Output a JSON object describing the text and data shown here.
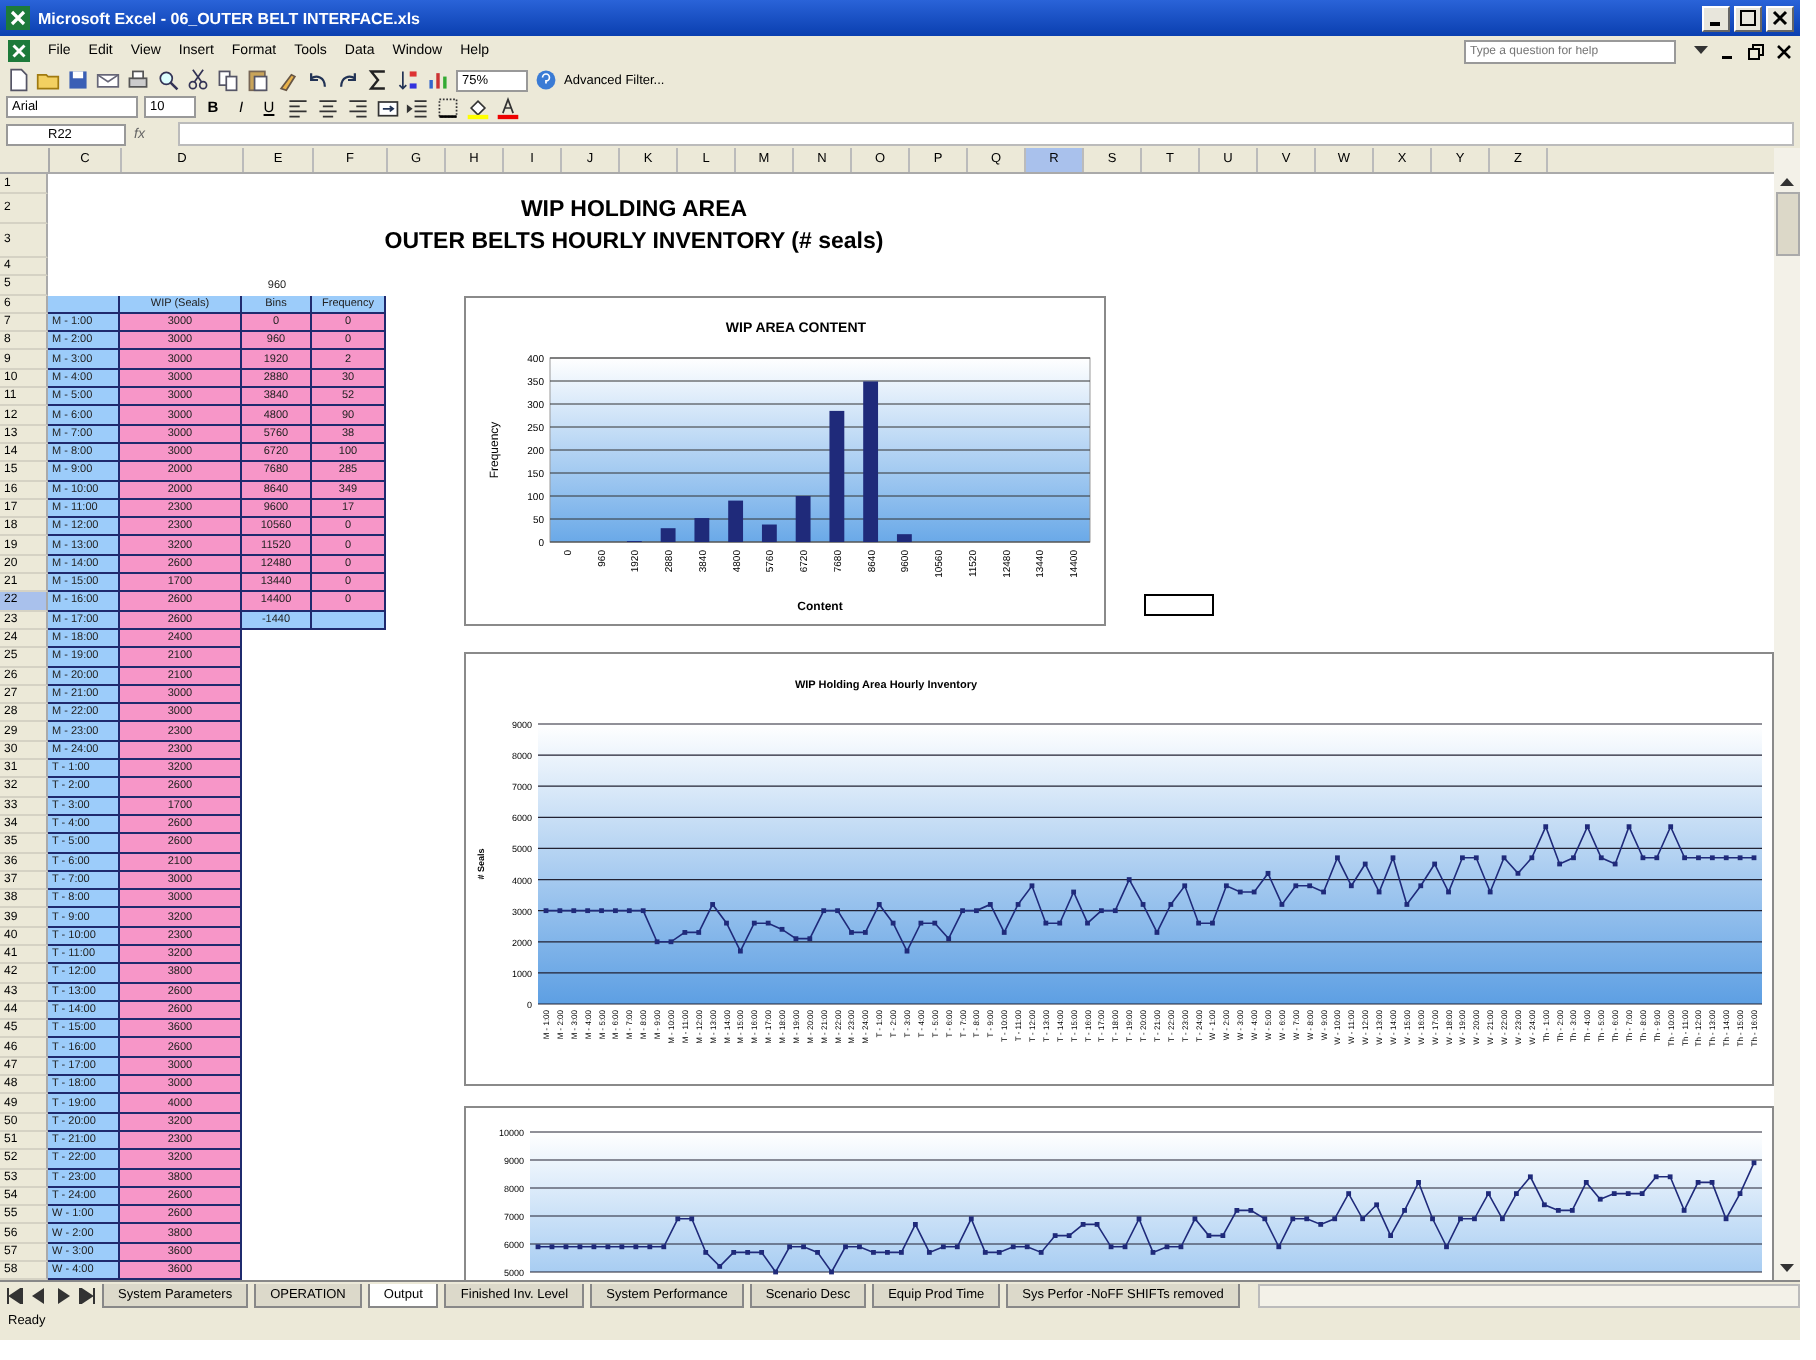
{
  "window": {
    "title": "Microsoft Excel - 06_OUTER BELT INTERFACE.xls"
  },
  "menu": [
    "File",
    "Edit",
    "View",
    "Insert",
    "Format",
    "Tools",
    "Data",
    "Window",
    "Help"
  ],
  "help_box": {
    "placeholder": "Type a question for help"
  },
  "toolbar": {
    "zoom": "75%",
    "advanced_filter": "Advanced Filter..."
  },
  "format_bar": {
    "font": "Arial",
    "size": "10",
    "buttons": [
      "B",
      "I",
      "U"
    ]
  },
  "formula_bar": {
    "name_box": "R22",
    "fx": "fx"
  },
  "sheet": {
    "columns": [
      {
        "label": "C",
        "selected": false
      },
      {
        "label": "D",
        "selected": false
      },
      {
        "label": "E",
        "selected": false
      },
      {
        "label": "F",
        "selected": false
      },
      {
        "label": "G",
        "selected": false
      },
      {
        "label": "H",
        "selected": false
      },
      {
        "label": "I",
        "selected": false
      },
      {
        "label": "J",
        "selected": false
      },
      {
        "label": "K",
        "selected": false
      },
      {
        "label": "L",
        "selected": false
      },
      {
        "label": "M",
        "selected": false
      },
      {
        "label": "N",
        "selected": false
      },
      {
        "label": "O",
        "selected": false
      },
      {
        "label": "P",
        "selected": false
      },
      {
        "label": "Q",
        "selected": false
      },
      {
        "label": "R",
        "selected": true
      },
      {
        "label": "S",
        "selected": false
      },
      {
        "label": "T",
        "selected": false
      },
      {
        "label": "U",
        "selected": false
      },
      {
        "label": "V",
        "selected": false
      },
      {
        "label": "W",
        "selected": false
      },
      {
        "label": "X",
        "selected": false
      },
      {
        "label": "Y",
        "selected": false
      },
      {
        "label": "Z",
        "selected": false
      }
    ],
    "rows": [
      {
        "number": "1",
        "selected": false,
        "kind": "blank"
      },
      {
        "number": "2",
        "selected": false,
        "kind": "title",
        "title": "WIP HOLDING AREA"
      },
      {
        "number": "3",
        "selected": false,
        "kind": "title",
        "title": "OUTER BELTS HOURLY INVENTORY (# seals)"
      },
      {
        "number": "4",
        "selected": false,
        "kind": "blank"
      },
      {
        "number": "5",
        "selected": false,
        "kind": "note",
        "bin": "960"
      },
      {
        "number": "6",
        "selected": false,
        "kind": "header",
        "wip": "WIP (Seals)",
        "bin": "Bins",
        "frequency": "Frequency"
      },
      {
        "number": "7",
        "selected": false,
        "kind": "data",
        "time": "M - 1:00",
        "wip": "3000",
        "bin": "0",
        "frequency": "0"
      },
      {
        "number": "8",
        "selected": false,
        "kind": "data",
        "time": "M - 2:00",
        "wip": "3000",
        "bin": "960",
        "frequency": "0"
      },
      {
        "number": "9",
        "selected": false,
        "kind": "data",
        "time": "M - 3:00",
        "wip": "3000",
        "bin": "1920",
        "frequency": "2"
      },
      {
        "number": "10",
        "selected": false,
        "kind": "data",
        "time": "M - 4:00",
        "wip": "3000",
        "bin": "2880",
        "frequency": "30"
      },
      {
        "number": "11",
        "selected": false,
        "kind": "data",
        "time": "M - 5:00",
        "wip": "3000",
        "bin": "3840",
        "frequency": "52"
      },
      {
        "number": "12",
        "selected": false,
        "kind": "data",
        "time": "M - 6:00",
        "wip": "3000",
        "bin": "4800",
        "frequency": "90"
      },
      {
        "number": "13",
        "selected": false,
        "kind": "data",
        "time": "M - 7:00",
        "wip": "3000",
        "bin": "5760",
        "frequency": "38"
      },
      {
        "number": "14",
        "selected": false,
        "kind": "data",
        "time": "M - 8:00",
        "wip": "3000",
        "bin": "6720",
        "frequency": "100"
      },
      {
        "number": "15",
        "selected": false,
        "kind": "data",
        "time": "M - 9:00",
        "wip": "2000",
        "bin": "7680",
        "frequency": "285"
      },
      {
        "number": "16",
        "selected": false,
        "kind": "data",
        "time": "M - 10:00",
        "wip": "2000",
        "bin": "8640",
        "frequency": "349"
      },
      {
        "number": "17",
        "selected": false,
        "kind": "data",
        "time": "M - 11:00",
        "wip": "2300",
        "bin": "9600",
        "frequency": "17"
      },
      {
        "number": "18",
        "selected": false,
        "kind": "data",
        "time": "M - 12:00",
        "wip": "2300",
        "bin": "10560",
        "frequency": "0"
      },
      {
        "number": "19",
        "selected": false,
        "kind": "data",
        "time": "M - 13:00",
        "wip": "3200",
        "bin": "11520",
        "frequency": "0"
      },
      {
        "number": "20",
        "selected": false,
        "kind": "data",
        "time": "M - 14:00",
        "wip": "2600",
        "bin": "12480",
        "frequency": "0"
      },
      {
        "number": "21",
        "selected": false,
        "kind": "data",
        "time": "M - 15:00",
        "wip": "1700",
        "bin": "13440",
        "frequency": "0"
      },
      {
        "number": "22",
        "selected": true,
        "kind": "data",
        "time": "M - 16:00",
        "wip": "2600",
        "bin": "14400",
        "frequency": "0"
      },
      {
        "number": "23",
        "selected": false,
        "kind": "data",
        "time": "M - 17:00",
        "wip": "2600",
        "bin": "-1440"
      },
      {
        "number": "24",
        "selected": false,
        "kind": "data",
        "time": "M - 18:00",
        "wip": "2400"
      },
      {
        "number": "25",
        "selected": false,
        "kind": "data",
        "time": "M - 19:00",
        "wip": "2100"
      },
      {
        "number": "26",
        "selected": false,
        "kind": "data",
        "time": "M - 20:00",
        "wip": "2100"
      },
      {
        "number": "27",
        "selected": false,
        "kind": "data",
        "time": "M - 21:00",
        "wip": "3000"
      },
      {
        "number": "28",
        "selected": false,
        "kind": "data",
        "time": "M - 22:00",
        "wip": "3000"
      },
      {
        "number": "29",
        "selected": false,
        "kind": "data",
        "time": "M - 23:00",
        "wip": "2300"
      },
      {
        "number": "30",
        "selected": false,
        "kind": "data",
        "time": "M - 24:00",
        "wip": "2300"
      },
      {
        "number": "31",
        "selected": false,
        "kind": "data",
        "time": "T - 1:00",
        "wip": "3200"
      },
      {
        "number": "32",
        "selected": false,
        "kind": "data",
        "time": "T - 2:00",
        "wip": "2600"
      },
      {
        "number": "33",
        "selected": false,
        "kind": "data",
        "time": "T - 3:00",
        "wip": "1700"
      },
      {
        "number": "34",
        "selected": false,
        "kind": "data",
        "time": "T - 4:00",
        "wip": "2600"
      },
      {
        "number": "35",
        "selected": false,
        "kind": "data",
        "time": "T - 5:00",
        "wip": "2600"
      },
      {
        "number": "36",
        "selected": false,
        "kind": "data",
        "time": "T - 6:00",
        "wip": "2100"
      },
      {
        "number": "37",
        "selected": false,
        "kind": "data",
        "time": "T - 7:00",
        "wip": "3000"
      },
      {
        "number": "38",
        "selected": false,
        "kind": "data",
        "time": "T - 8:00",
        "wip": "3000"
      },
      {
        "number": "39",
        "selected": false,
        "kind": "data",
        "time": "T - 9:00",
        "wip": "3200"
      },
      {
        "number": "40",
        "selected": false,
        "kind": "data",
        "time": "T - 10:00",
        "wip": "2300"
      },
      {
        "number": "41",
        "selected": false,
        "kind": "data",
        "time": "T - 11:00",
        "wip": "3200"
      },
      {
        "number": "42",
        "selected": false,
        "kind": "data",
        "time": "T - 12:00",
        "wip": "3800"
      },
      {
        "number": "43",
        "selected": false,
        "kind": "data",
        "time": "T - 13:00",
        "wip": "2600"
      },
      {
        "number": "44",
        "selected": false,
        "kind": "data",
        "time": "T - 14:00",
        "wip": "2600"
      },
      {
        "number": "45",
        "selected": false,
        "kind": "data",
        "time": "T - 15:00",
        "wip": "3600"
      },
      {
        "number": "46",
        "selected": false,
        "kind": "data",
        "time": "T - 16:00",
        "wip": "2600"
      },
      {
        "number": "47",
        "selected": false,
        "kind": "data",
        "time": "T - 17:00",
        "wip": "3000"
      },
      {
        "number": "48",
        "selected": false,
        "kind": "data",
        "time": "T - 18:00",
        "wip": "3000"
      },
      {
        "number": "49",
        "selected": false,
        "kind": "data",
        "time": "T - 19:00",
        "wip": "4000"
      },
      {
        "number": "50",
        "selected": false,
        "kind": "data",
        "time": "T - 20:00",
        "wip": "3200"
      },
      {
        "number": "51",
        "selected": false,
        "kind": "data",
        "time": "T - 21:00",
        "wip": "2300"
      },
      {
        "number": "52",
        "selected": false,
        "kind": "data",
        "time": "T - 22:00",
        "wip": "3200"
      },
      {
        "number": "53",
        "selected": false,
        "kind": "data",
        "time": "T - 23:00",
        "wip": "3800"
      },
      {
        "number": "54",
        "selected": false,
        "kind": "data",
        "time": "T - 24:00",
        "wip": "2600"
      },
      {
        "number": "55",
        "selected": false,
        "kind": "data",
        "time": "W - 1:00",
        "wip": "2600"
      },
      {
        "number": "56",
        "selected": false,
        "kind": "data",
        "time": "W - 2:00",
        "wip": "3800"
      },
      {
        "number": "57",
        "selected": false,
        "kind": "data",
        "time": "W - 3:00",
        "wip": "3600"
      },
      {
        "number": "58",
        "selected": false,
        "kind": "data",
        "time": "W - 4:00",
        "wip": "3600"
      }
    ],
    "histogram": {
      "chart_data": {
        "type": "bar",
        "title": "WIP AREA CONTENT",
        "xlabel": "Content",
        "ylabel": "Frequency",
        "categories": [
          "0",
          "960",
          "1920",
          "2880",
          "3840",
          "4800",
          "5760",
          "6720",
          "7680",
          "8640",
          "9600",
          "10560",
          "11520",
          "12480",
          "13440",
          "14400"
        ],
        "values": [
          0,
          0,
          2,
          30,
          52,
          90,
          38,
          100,
          285,
          349,
          17,
          0,
          0,
          0,
          0,
          0
        ],
        "grid": true,
        "ylim": [
          0,
          400
        ],
        "yticks": [
          0,
          50,
          100,
          150,
          200,
          250,
          300,
          350,
          400
        ]
      }
    },
    "hourly_chart": {
      "chart_data": {
        "type": "line",
        "title": "WIP Holding Area Hourly Inventory",
        "ylabel": "# Seals",
        "categories": [
          "M - 1:00",
          "M - 2:00",
          "M - 3:00",
          "M - 4:00",
          "M - 5:00",
          "M - 6:00",
          "M - 7:00",
          "M - 8:00",
          "M - 9:00",
          "M - 10:00",
          "M - 11:00",
          "M - 12:00",
          "M - 13:00",
          "M - 14:00",
          "M - 15:00",
          "M - 16:00",
          "M - 17:00",
          "M - 18:00",
          "M - 19:00",
          "M - 20:00",
          "M - 21:00",
          "M - 22:00",
          "M - 23:00",
          "M - 24:00",
          "T - 1:00",
          "T - 2:00",
          "T - 3:00",
          "T - 4:00",
          "T - 5:00",
          "T - 6:00",
          "T - 7:00",
          "T - 8:00",
          "T - 9:00",
          "T - 10:00",
          "T - 11:00",
          "T - 12:00",
          "T - 13:00",
          "T - 14:00",
          "T - 15:00",
          "T - 16:00",
          "T - 17:00",
          "T - 18:00",
          "T - 19:00",
          "T - 20:00",
          "T - 21:00",
          "T - 22:00",
          "T - 23:00",
          "T - 24:00",
          "W - 1:00",
          "W - 2:00",
          "W - 3:00",
          "W - 4:00",
          "W - 5:00",
          "W - 6:00",
          "W - 7:00",
          "W - 8:00",
          "W - 9:00",
          "W - 10:00",
          "W - 11:00",
          "W - 12:00",
          "W - 13:00",
          "W - 14:00",
          "W - 15:00",
          "W - 16:00",
          "W - 17:00",
          "W - 18:00",
          "W - 19:00",
          "W - 20:00",
          "W - 21:00",
          "W - 22:00",
          "W - 23:00",
          "W - 24:00",
          "Th - 1:00",
          "Th - 2:00",
          "Th - 3:00",
          "Th - 4:00",
          "Th - 5:00",
          "Th - 6:00",
          "Th - 7:00",
          "Th - 8:00",
          "Th - 9:00",
          "Th - 10:00",
          "Th - 11:00",
          "Th - 12:00",
          "Th - 13:00",
          "Th - 14:00",
          "Th - 15:00",
          "Th - 16:00"
        ],
        "grid": true,
        "series": [
          {
            "color": "#1f2a7a",
            "marker": "square",
            "values": [
              3000,
              3000,
              3000,
              3000,
              3000,
              3000,
              3000,
              3000,
              2000,
              2000,
              2300,
              2300,
              3200,
              2600,
              1700,
              2600,
              2600,
              2400,
              2100,
              2100,
              3000,
              3000,
              2300,
              2300,
              3200,
              2600,
              1700,
              2600,
              2600,
              2100,
              3000,
              3000,
              3200,
              2300,
              3200,
              3800,
              2600,
              2600,
              3600,
              2600,
              3000,
              3000,
              4000,
              3200,
              2300,
              3200,
              3800,
              2600,
              2600,
              3800,
              3600,
              3600,
              4200,
              3200,
              3800,
              3800,
              3600,
              4700,
              3800,
              4500,
              3600,
              4700,
              3200,
              3800,
              4500,
              3600,
              4700,
              4700,
              3600,
              4700,
              4200,
              4700,
              5700,
              4500,
              4700,
              5700,
              4700,
              4500,
              5700,
              4700,
              4700,
              5700,
              4700,
              4700,
              4700,
              4700,
              4700,
              4700
            ]
          }
        ],
        "ylim": [
          0,
          9000
        ],
        "yticks": [
          0,
          1000,
          2000,
          3000,
          4000,
          5000,
          6000,
          7000,
          8000,
          9000
        ]
      }
    },
    "second_chart": {
      "chart_data": {
        "type": "line",
        "grid": true,
        "series": [
          {
            "color": "#1f2a7a",
            "marker": "square",
            "values": [
              5900,
              5900,
              5900,
              5900,
              5900,
              5900,
              5900,
              5900,
              5900,
              5900,
              6900,
              6900,
              5700,
              5200,
              5700,
              5700,
              5700,
              5000,
              5900,
              5900,
              5700,
              5000,
              5900,
              5900,
              5700,
              5700,
              5700,
              6700,
              5700,
              5900,
              5900,
              6900,
              5700,
              5700,
              5900,
              5900,
              5700,
              6300,
              6300,
              6700,
              6700,
              5900,
              5900,
              6900,
              5700,
              5900,
              5900,
              6900,
              6300,
              6300,
              7200,
              7200,
              6900,
              5900,
              6900,
              6900,
              6700,
              6900,
              7800,
              6900,
              7400,
              6300,
              7200,
              8200,
              6900,
              5900,
              6900,
              6900,
              7800,
              6900,
              7800,
              8400,
              7400,
              7200,
              7200,
              8200,
              7600,
              7800,
              7800,
              7800,
              8400,
              8400,
              7200,
              8200,
              8200,
              6900,
              7800,
              8900
            ]
          }
        ],
        "ylim": [
          5000,
          10000
        ],
        "yticks": [
          5000,
          6000,
          7000,
          8000,
          9000,
          10000
        ]
      }
    }
  },
  "tabs": [
    {
      "label": "System Parameters",
      "selected": false
    },
    {
      "label": "OPERATION",
      "selected": false
    },
    {
      "label": "Output",
      "selected": true
    },
    {
      "label": "Finished Inv. Level",
      "selected": false
    },
    {
      "label": "System Performance",
      "selected": false
    },
    {
      "label": "Scenario Desc",
      "selected": false
    },
    {
      "label": "Equip Prod Time",
      "selected": false
    },
    {
      "label": "Sys Perfor -NoFF SHIFTs removed",
      "selected": false
    }
  ],
  "status_bar": {
    "text": "Ready"
  }
}
